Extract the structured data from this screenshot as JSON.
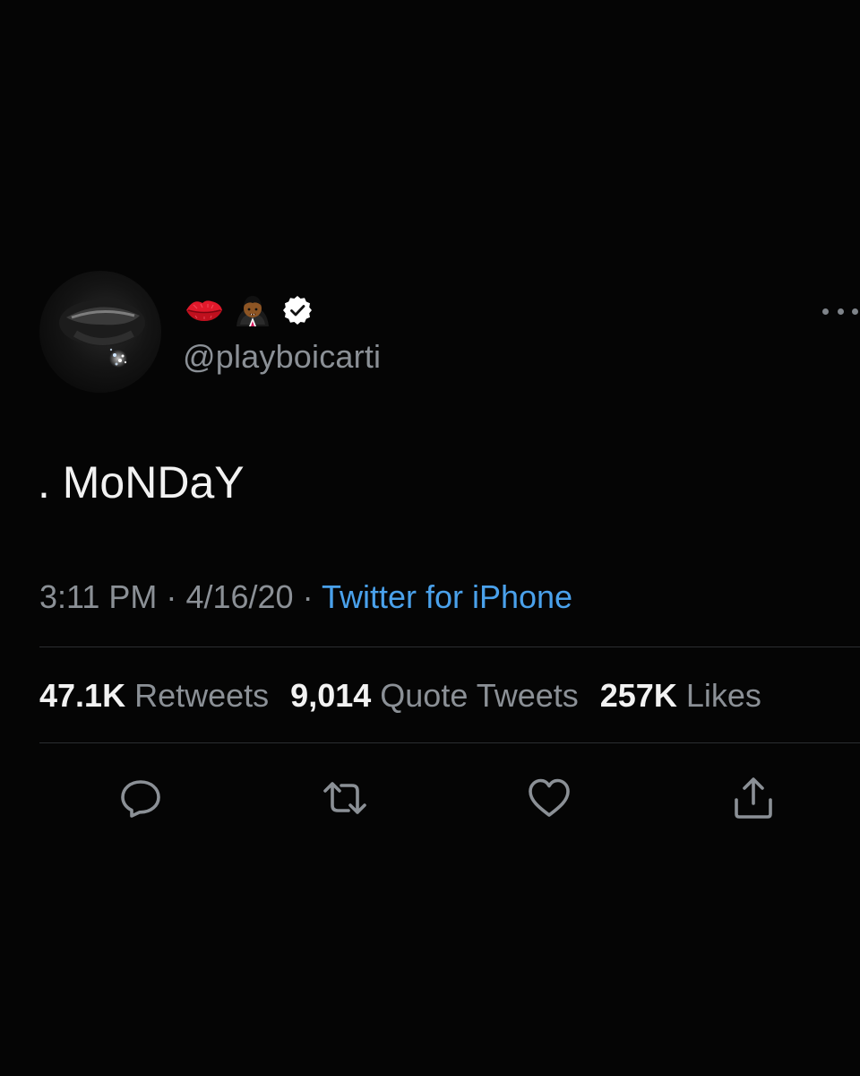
{
  "tweet": {
    "handle": "@playboicarti",
    "text": ". MoNDaY",
    "time": "3:11 PM",
    "separator": "·",
    "date": "4/16/20",
    "source": "Twitter for iPhone",
    "name_icons": [
      "kiss-mark-icon",
      "vampire-icon",
      "verified-badge-icon"
    ]
  },
  "stats": {
    "retweets_count": "47.1K",
    "retweets_label": "Retweets",
    "quote_count": "9,014",
    "quote_label": "Quote Tweets",
    "likes_count": "257K",
    "likes_label": "Likes"
  },
  "actions": {
    "icons": [
      "reply-icon",
      "retweet-icon",
      "like-icon",
      "share-icon"
    ]
  },
  "colors": {
    "background": "#050505",
    "text": "#f2f2f2",
    "secondary": "#8b9096",
    "link": "#4aa1eb",
    "divider": "#2b2e31"
  }
}
